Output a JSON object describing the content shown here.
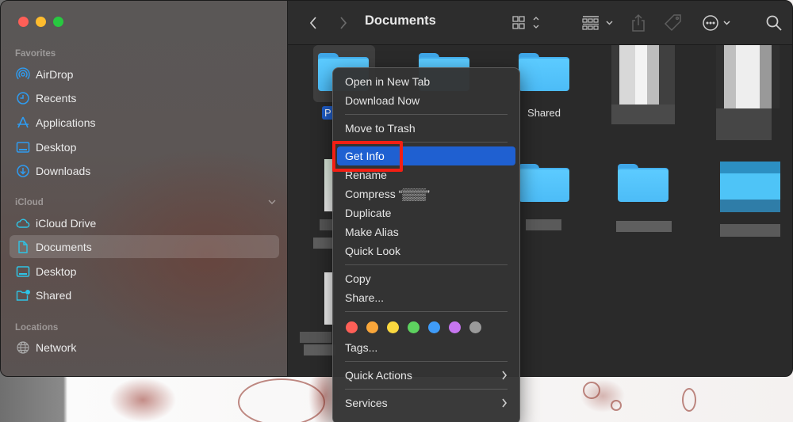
{
  "window": {
    "title": "Documents"
  },
  "sidebar": {
    "sections": [
      {
        "label": "Favorites",
        "items": [
          {
            "label": "AirDrop",
            "icon": "airdrop-icon"
          },
          {
            "label": "Recents",
            "icon": "clock-icon"
          },
          {
            "label": "Applications",
            "icon": "applications-icon"
          },
          {
            "label": "Desktop",
            "icon": "desktop-icon"
          },
          {
            "label": "Downloads",
            "icon": "download-icon"
          }
        ]
      },
      {
        "label": "iCloud",
        "items": [
          {
            "label": "iCloud Drive",
            "icon": "cloud-icon"
          },
          {
            "label": "Documents",
            "icon": "document-icon",
            "selected": true
          },
          {
            "label": "Desktop",
            "icon": "desktop-icon"
          },
          {
            "label": "Shared",
            "icon": "shared-folder-icon"
          }
        ]
      },
      {
        "label": "Locations",
        "items": [
          {
            "label": "Network",
            "icon": "globe-icon"
          }
        ]
      }
    ]
  },
  "toolbar": {
    "back": "back-icon",
    "forward": "forward-icon",
    "title": "Documents",
    "view": "icon-view-icon",
    "group": "group-icon",
    "share": "share-icon",
    "tag": "tag-icon",
    "more": "more-icon",
    "search": "search-icon"
  },
  "content": {
    "items": [
      {
        "label": "P",
        "selected": true
      },
      {
        "label": ""
      },
      {
        "label": "Shared"
      },
      {
        "label": ""
      },
      {
        "label": ""
      },
      {
        "label": ""
      },
      {
        "label": ""
      },
      {
        "label": ""
      },
      {
        "label": ""
      }
    ]
  },
  "context_menu": {
    "groups": [
      [
        "Open in New Tab",
        "Download Now"
      ],
      [
        "Move to Trash"
      ],
      [
        "Get Info",
        "Rename",
        "Compress “▒▒▒”",
        "Duplicate",
        "Make Alias",
        "Quick Look"
      ],
      [
        "Copy",
        "Share..."
      ]
    ],
    "highlighted": "Get Info",
    "tag_colors": [
      "#fe5f57",
      "#f9a63a",
      "#fbd83f",
      "#5dd25f",
      "#3f9cf9",
      "#c776f0",
      "#9a9a9a"
    ],
    "tags_label": "Tags...",
    "submenus": [
      "Quick Actions",
      "Services"
    ]
  },
  "annotation": {
    "highlight_color": "#f21f14",
    "target": "Get Info"
  }
}
